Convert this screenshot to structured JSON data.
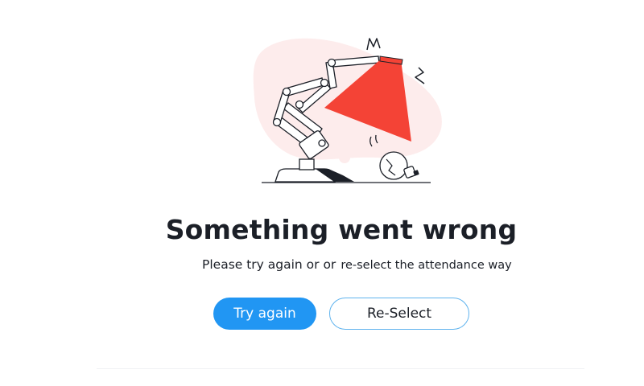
{
  "error": {
    "title": "Something went wrong",
    "message_part1": "Please try again or or",
    "message_part2": "re-select the attendance way"
  },
  "actions": {
    "try_again_label": "Try again",
    "reselect_label": "Re-Select"
  },
  "colors": {
    "primary": "#2196f3",
    "secondary_border": "#5fb3ee",
    "lamp_shade": "#f44336",
    "blob": "#fdecec",
    "text": "#1b1f27"
  },
  "icons": {
    "illustration": "broken-lamp-illustration"
  }
}
